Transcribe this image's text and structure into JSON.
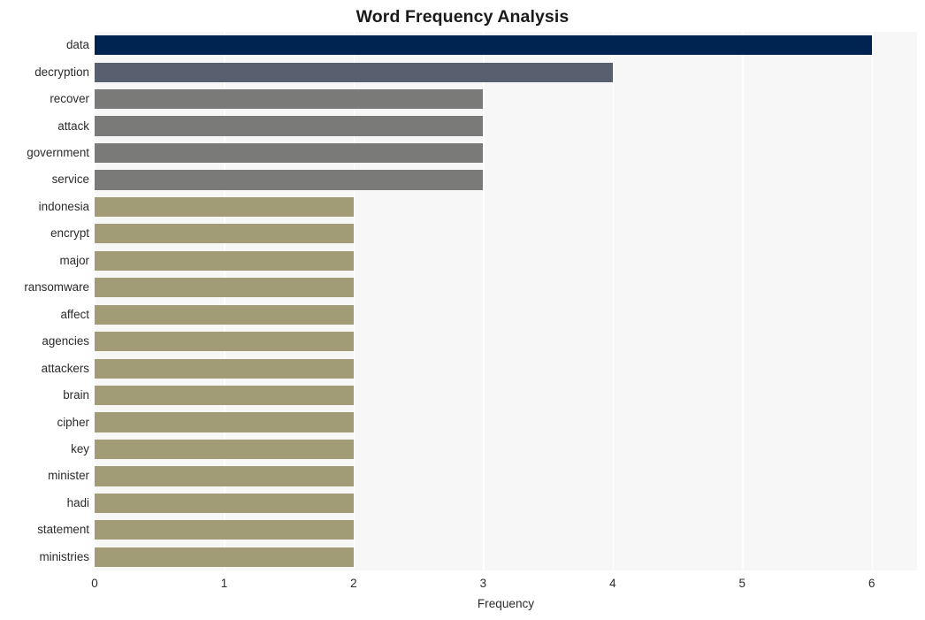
{
  "chart_data": {
    "type": "bar",
    "orientation": "horizontal",
    "title": "Word Frequency Analysis",
    "xlabel": "Frequency",
    "ylabel": "",
    "xlim": [
      0,
      6.35
    ],
    "xticks": [
      0,
      1,
      2,
      3,
      4,
      5,
      6
    ],
    "xtick_labels": [
      "0",
      "1",
      "2",
      "3",
      "4",
      "5",
      "6"
    ],
    "grid": "vertical-only",
    "legend": "none",
    "categories": [
      "data",
      "decryption",
      "recover",
      "attack",
      "government",
      "service",
      "indonesia",
      "encrypt",
      "major",
      "ransomware",
      "affect",
      "agencies",
      "attackers",
      "brain",
      "cipher",
      "key",
      "minister",
      "hadi",
      "statement",
      "ministries"
    ],
    "values": [
      6,
      4,
      3,
      3,
      3,
      3,
      2,
      2,
      2,
      2,
      2,
      2,
      2,
      2,
      2,
      2,
      2,
      2,
      2,
      2
    ],
    "bar_colors": [
      "#002451",
      "#585f6f",
      "#7a7a78",
      "#7a7a78",
      "#7a7a78",
      "#7a7a78",
      "#a29c76",
      "#a29c76",
      "#a29c76",
      "#a29c76",
      "#a29c76",
      "#a29c76",
      "#a29c76",
      "#a29c76",
      "#a29c76",
      "#a29c76",
      "#a29c76",
      "#a29c76",
      "#a29c76",
      "#a29c76"
    ]
  },
  "style": {
    "plot_background": "#f7f7f7",
    "figure_background": "#ffffff",
    "gridline_color": "#ffffff",
    "text_color": "#2b2b2b",
    "title_color": "#1a1a1a"
  }
}
